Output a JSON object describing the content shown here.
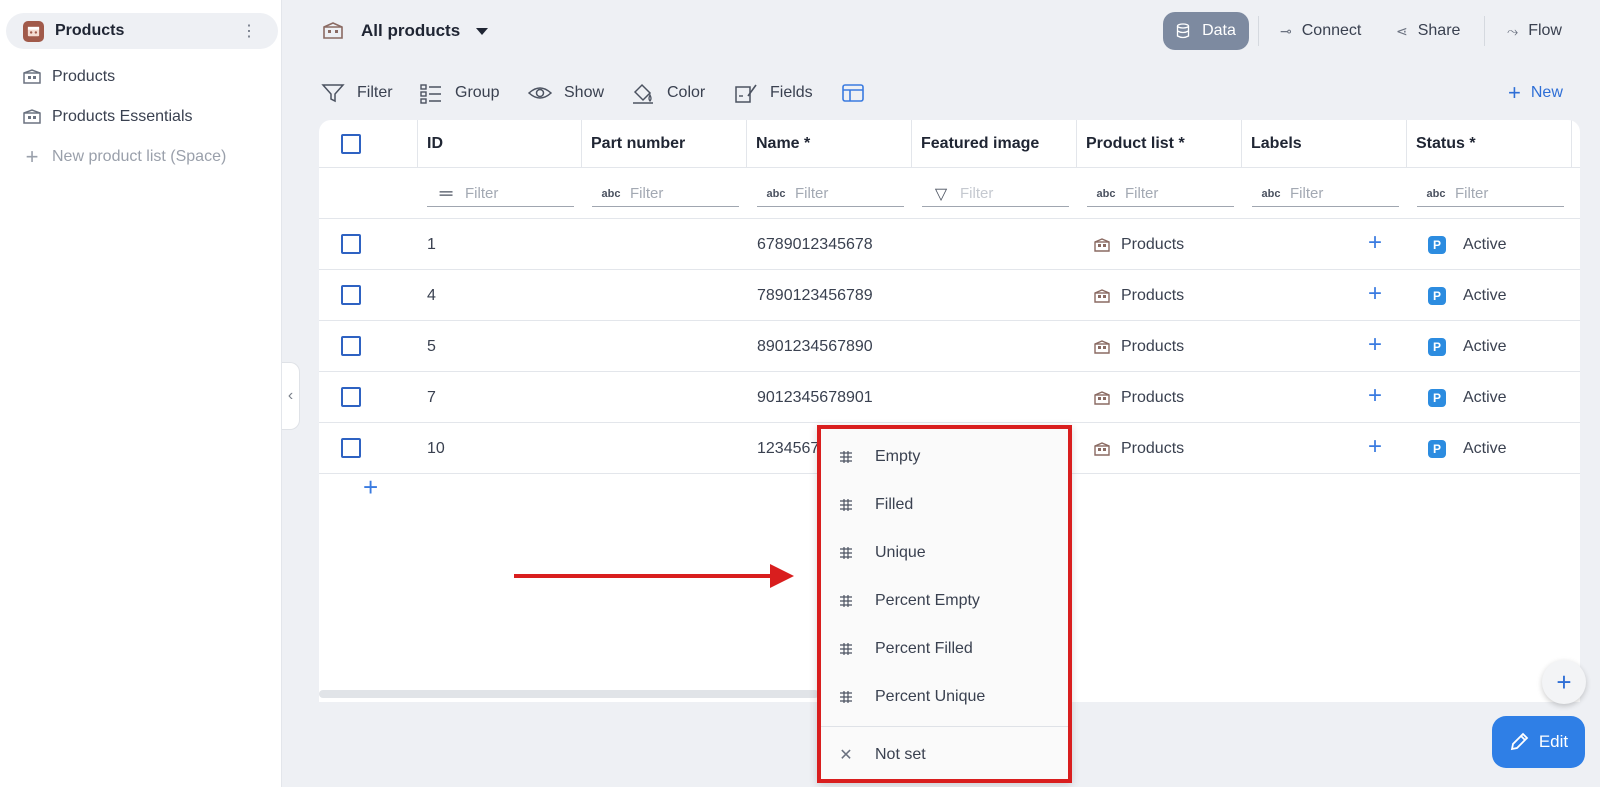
{
  "sidebar": {
    "space_title": "Products",
    "menu_icon": "more-vertical-icon",
    "items": [
      {
        "label": "Products",
        "icon": "product-list-icon"
      },
      {
        "label": "Products Essentials",
        "icon": "product-list-icon"
      },
      {
        "label": "New product list (Space)",
        "icon": "plus-icon"
      }
    ]
  },
  "header": {
    "view_title": "All products",
    "nav": [
      {
        "label": "Data",
        "icon": "database-icon",
        "active": true
      },
      {
        "label": "Connect",
        "icon": "connect-icon"
      },
      {
        "label": "Share",
        "icon": "share-icon"
      },
      {
        "label": "Flow",
        "icon": "flow-icon"
      }
    ]
  },
  "toolbar": {
    "filter": "Filter",
    "group": "Group",
    "show": "Show",
    "color": "Color",
    "fields": "Fields",
    "new": "New"
  },
  "table": {
    "columns": [
      "ID",
      "Part number",
      "Name *",
      "Featured image",
      "Product list *",
      "Labels",
      "Status *"
    ],
    "filter_placeholder": "Filter",
    "rows": [
      {
        "id": "1",
        "part_number": "",
        "name": "6789012345678",
        "product_list": "Products",
        "status": "Active"
      },
      {
        "id": "4",
        "part_number": "",
        "name": "7890123456789",
        "product_list": "Products",
        "status": "Active"
      },
      {
        "id": "5",
        "part_number": "",
        "name": "8901234567890",
        "product_list": "Products",
        "status": "Active"
      },
      {
        "id": "7",
        "part_number": "",
        "name": "9012345678901",
        "product_list": "Products",
        "status": "Active"
      },
      {
        "id": "10",
        "part_number": "",
        "name": "1234567",
        "product_list": "Products",
        "status": "Active"
      }
    ],
    "status_badge": "P"
  },
  "dropdown": {
    "items": [
      "Empty",
      "Filled",
      "Unique",
      "Percent Empty",
      "Percent Filled",
      "Percent Unique"
    ],
    "clear": "Not set"
  },
  "actions": {
    "edit": "Edit"
  },
  "colors": {
    "accent": "#2f7fe6",
    "highlight": "#d91e1e",
    "data_button": "#7d8aa0"
  }
}
